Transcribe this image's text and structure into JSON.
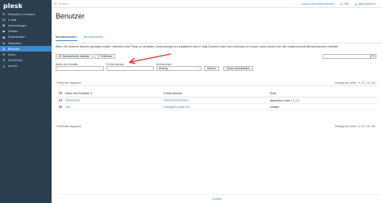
{
  "app": {
    "logo": "plesk"
  },
  "sidebar": {
    "items": [
      {
        "label": "Websites & Domains",
        "icon": "globe-icon",
        "active": false
      },
      {
        "label": "E-Mail",
        "icon": "mail-icon",
        "active": false
      },
      {
        "label": "Anwendungen",
        "icon": "apps-icon",
        "active": false
      },
      {
        "label": "Dateien",
        "icon": "folder-icon",
        "active": false
      },
      {
        "label": "Datenbanken",
        "icon": "database-icon",
        "active": false
      },
      {
        "label": "Statistiken",
        "icon": "chart-icon",
        "active": false
      },
      {
        "label": "Benutzer",
        "icon": "user-icon",
        "active": true
      },
      {
        "label": "Konto",
        "icon": "account-icon",
        "active": false
      },
      {
        "label": "WordPress",
        "icon": "wordpress-icon",
        "active": false
      },
      {
        "label": "joomla!",
        "icon": "joomla-icon",
        "active": false
      }
    ]
  },
  "topbar": {
    "search_placeholder": "Suchen...",
    "links": {
      "back": "Zurück zum Reseller-Bereich",
      "help": "Hilfe",
      "user": "glitch-testen.de"
    }
  },
  "page": {
    "title": "Benutzer",
    "tabs": [
      "Benutzerkonten",
      "Benutzerrollen"
    ],
    "description": "Wenn Sie anderen Nutzern gestatten wollen, Websites über Plesk zu verwalten, Anwendungen zu installieren oder E-Mail-Services unter Ihren Domains zu nutzen, dann können Sie hier entsprechende Benutzerkonten erstellen."
  },
  "toolbar": {
    "create_label": "Benutzerkonto erstellen",
    "remove_label": "Entfernen"
  },
  "filters": {
    "name_label": "Name des Kontakts",
    "email_label": "E-Mail-Adresse",
    "role_label": "Benutzerrolle",
    "role_value": "Beliebig",
    "search_label": "Suchen",
    "reset_label": "Suche zurücksetzen"
  },
  "list": {
    "count_text": "2 Elemente insgesamt",
    "per_page_label": "Einträge pro Seite:",
    "per_page_options": [
      "10",
      "25",
      "100",
      "Alle"
    ],
    "headers": [
      "Name des Kontakts",
      "E-Mail-Adresse",
      "Rolle"
    ],
    "rows": [
      {
        "name": "",
        "email": "",
        "role": "Application User 1 1 1 1"
      },
      {
        "name": "Test",
        "email": "test@glitch-testen.de",
        "role": "Inhaber"
      }
    ],
    "count_text_bottom": "2 Elemente insgesamt"
  },
  "footer": {
    "cookies": "Cookies"
  },
  "colors": {
    "sidebar": "#2b3e50",
    "accent": "#3b8bd1",
    "arrow": "#d9302c"
  }
}
